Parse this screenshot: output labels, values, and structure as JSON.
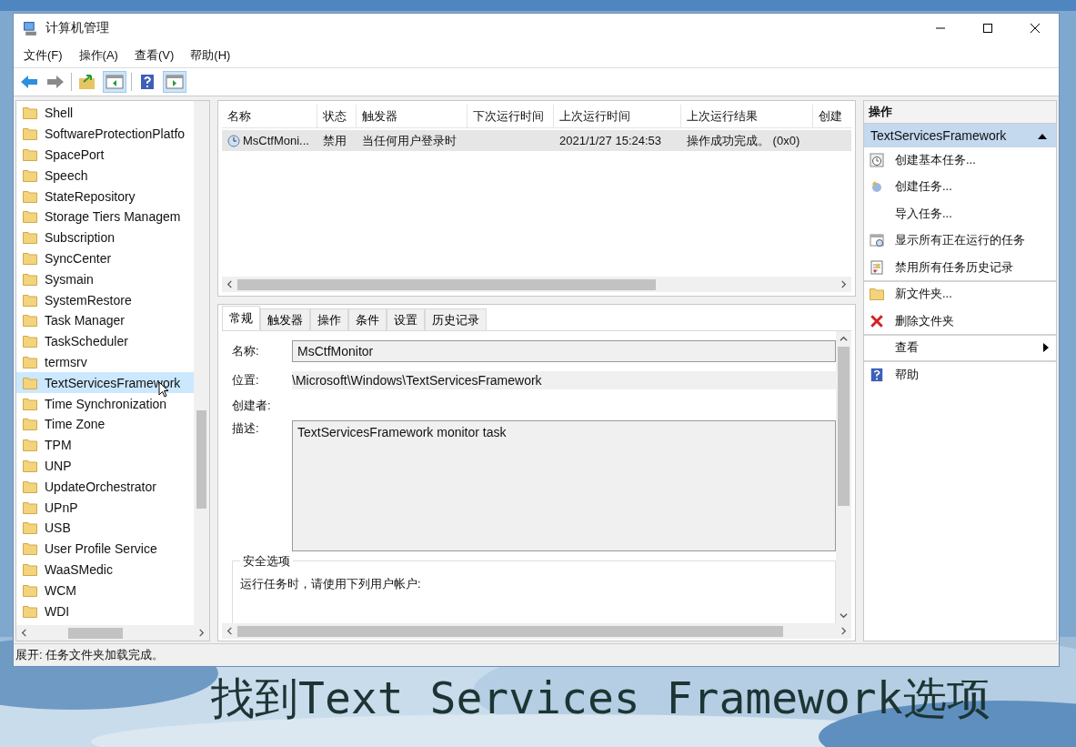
{
  "window": {
    "title": "计算机管理"
  },
  "menu": [
    "文件(F)",
    "操作(A)",
    "查看(V)",
    "帮助(H)"
  ],
  "tree": {
    "items": [
      {
        "label": "Shell",
        "selected": false
      },
      {
        "label": "SoftwareProtectionPlatfo",
        "selected": false
      },
      {
        "label": "SpacePort",
        "selected": false
      },
      {
        "label": "Speech",
        "selected": false
      },
      {
        "label": "StateRepository",
        "selected": false
      },
      {
        "label": "Storage Tiers Managem",
        "selected": false
      },
      {
        "label": "Subscription",
        "selected": false
      },
      {
        "label": "SyncCenter",
        "selected": false
      },
      {
        "label": "Sysmain",
        "selected": false
      },
      {
        "label": "SystemRestore",
        "selected": false
      },
      {
        "label": "Task Manager",
        "selected": false
      },
      {
        "label": "TaskScheduler",
        "selected": false
      },
      {
        "label": "termsrv",
        "selected": false
      },
      {
        "label": "TextServicesFramework",
        "selected": true
      },
      {
        "label": "Time Synchronization",
        "selected": false
      },
      {
        "label": "Time Zone",
        "selected": false
      },
      {
        "label": "TPM",
        "selected": false
      },
      {
        "label": "UNP",
        "selected": false
      },
      {
        "label": "UpdateOrchestrator",
        "selected": false
      },
      {
        "label": "UPnP",
        "selected": false
      },
      {
        "label": "USB",
        "selected": false
      },
      {
        "label": "User Profile Service",
        "selected": false
      },
      {
        "label": "WaaSMedic",
        "selected": false
      },
      {
        "label": "WCM",
        "selected": false
      },
      {
        "label": "WDI",
        "selected": false
      }
    ]
  },
  "task_table": {
    "columns": [
      "名称",
      "状态",
      "触发器",
      "下次运行时间",
      "上次运行时间",
      "上次运行结果",
      "创建"
    ],
    "rows": [
      {
        "selected": true,
        "cells": [
          "MsCtfMoni...",
          "禁用",
          "当任何用户登录时",
          "",
          "2021/1/27 15:24:53",
          "操作成功完成。 (0x0)"
        ]
      }
    ]
  },
  "detail": {
    "tabs": [
      {
        "label": "常规",
        "selected": true
      },
      {
        "label": "触发器",
        "selected": false
      },
      {
        "label": "操作",
        "selected": false
      },
      {
        "label": "条件",
        "selected": false
      },
      {
        "label": "设置",
        "selected": false
      },
      {
        "label": "历史记录",
        "selected": false
      }
    ],
    "name_label": "名称:",
    "name_value": "MsCtfMonitor",
    "location_label": "位置:",
    "location_value": "\\Microsoft\\Windows\\TextServicesFramework",
    "author_label": "创建者:",
    "description_label": "描述:",
    "description_value": "TextServicesFramework monitor task",
    "security_title": "安全选项",
    "security_text": "运行任务时，请使用下列用户帐户:"
  },
  "actions": {
    "title": "操作",
    "section": "TextServicesFramework",
    "items": [
      {
        "kind": "basic-task",
        "label": "创建基本任务...",
        "separator_after": false
      },
      {
        "kind": "task",
        "label": "创建任务...",
        "separator_after": false
      },
      {
        "kind": "plain",
        "label": "导入任务...",
        "separator_after": false
      },
      {
        "kind": "running",
        "label": "显示所有正在运行的任务",
        "separator_after": false
      },
      {
        "kind": "history",
        "label": "禁用所有任务历史记录",
        "separator_after": true
      },
      {
        "kind": "folder",
        "label": "新文件夹...",
        "separator_after": false
      },
      {
        "kind": "delete",
        "label": "删除文件夹",
        "separator_after": true
      },
      {
        "kind": "submenu",
        "label": "查看",
        "separator_after": true
      },
      {
        "kind": "help",
        "label": "帮助",
        "separator_after": false
      }
    ]
  },
  "status_bar": "展开: 任务文件夹加载完成。",
  "caption": "找到Text Services Framework选项"
}
